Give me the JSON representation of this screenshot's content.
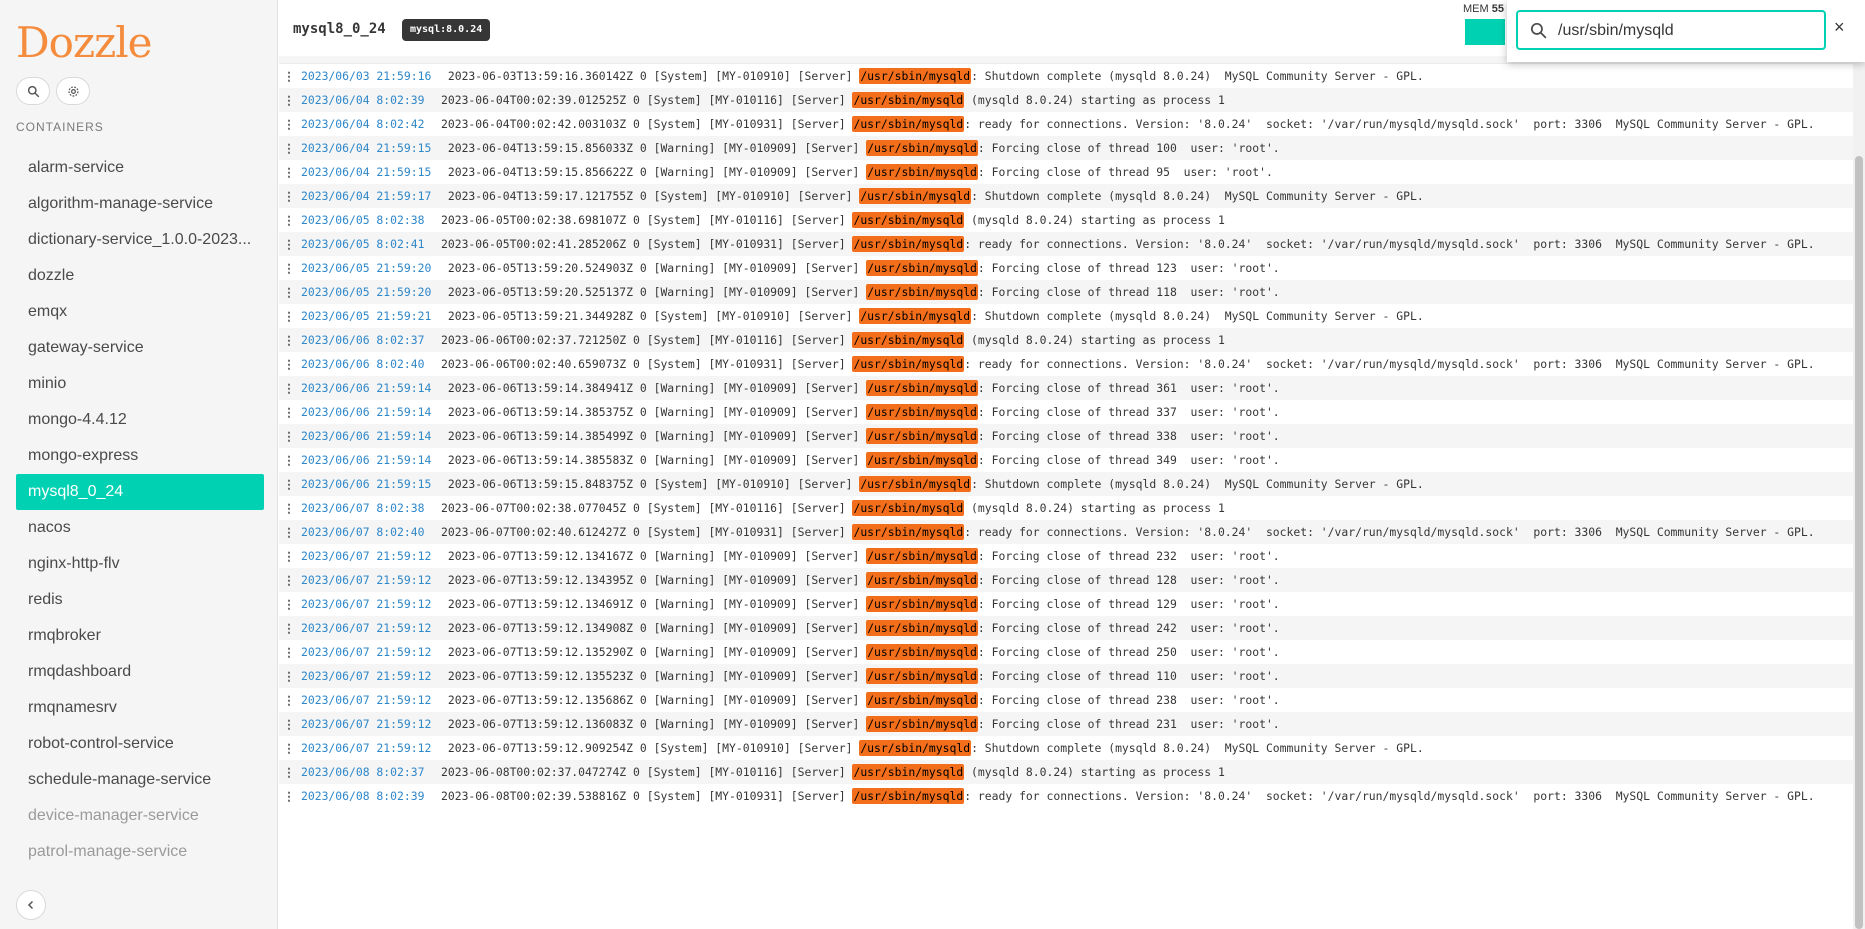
{
  "app": {
    "logo": "Dozzle"
  },
  "sidebar": {
    "section_label": "CONTAINERS",
    "search_icon": "search-icon",
    "settings_icon": "gear-icon",
    "collapse_icon": "chevron-left-icon",
    "containers": [
      {
        "label": "alarm-service",
        "state": "running"
      },
      {
        "label": "algorithm-manage-service",
        "state": "running"
      },
      {
        "label": "dictionary-service_1.0.0-2023...",
        "state": "running"
      },
      {
        "label": "dozzle",
        "state": "running"
      },
      {
        "label": "emqx",
        "state": "running"
      },
      {
        "label": "gateway-service",
        "state": "running"
      },
      {
        "label": "minio",
        "state": "running"
      },
      {
        "label": "mongo-4.4.12",
        "state": "running"
      },
      {
        "label": "mongo-express",
        "state": "running"
      },
      {
        "label": "mysql8_0_24",
        "state": "active"
      },
      {
        "label": "nacos",
        "state": "running"
      },
      {
        "label": "nginx-http-flv",
        "state": "running"
      },
      {
        "label": "redis",
        "state": "running"
      },
      {
        "label": "rmqbroker",
        "state": "running"
      },
      {
        "label": "rmqdashboard",
        "state": "running"
      },
      {
        "label": "rmqnamesrv",
        "state": "running"
      },
      {
        "label": "robot-control-service",
        "state": "running"
      },
      {
        "label": "schedule-manage-service",
        "state": "running"
      },
      {
        "label": "device-manager-service",
        "state": "stopped"
      },
      {
        "label": "patrol-manage-service",
        "state": "stopped"
      }
    ]
  },
  "header": {
    "container_name": "mysql8_0_24",
    "image_tag": "mysql:8.0.24",
    "mem_label": "MEM",
    "mem_value": "55"
  },
  "search": {
    "value": "/usr/sbin/mysqld",
    "close_label": "×"
  },
  "colors": {
    "accent": "#00d1b2",
    "highlight": "#f26e1a",
    "date": "#2e87c9",
    "logo": "#f48b3d"
  },
  "logs": [
    {
      "date": "2023/06/03 21:59:16",
      "pre": " 2023-06-03T13:59:16.360142Z 0 [System] [MY-010910] [Server] ",
      "match": "/usr/sbin/mysqld",
      "post": ": Shutdown complete (mysqld 8.0.24)  MySQL Community Server - GPL."
    },
    {
      "date": "2023/06/04 8:02:39",
      "pre": "2023-06-04T00:02:39.012525Z 0 [System] [MY-010116] [Server] ",
      "match": "/usr/sbin/mysqld",
      "post": " (mysqld 8.0.24) starting as process 1"
    },
    {
      "date": "2023/06/04 8:02:42",
      "pre": "2023-06-04T00:02:42.003103Z 0 [System] [MY-010931] [Server] ",
      "match": "/usr/sbin/mysqld",
      "post": ": ready for connections. Version: '8.0.24'  socket: '/var/run/mysqld/mysqld.sock'  port: 3306  MySQL Community Server - GPL."
    },
    {
      "date": "2023/06/04 21:59:15",
      "pre": " 2023-06-04T13:59:15.856033Z 0 [Warning] [MY-010909] [Server] ",
      "match": "/usr/sbin/mysqld",
      "post": ": Forcing close of thread 100  user: 'root'."
    },
    {
      "date": "2023/06/04 21:59:15",
      "pre": " 2023-06-04T13:59:15.856622Z 0 [Warning] [MY-010909] [Server] ",
      "match": "/usr/sbin/mysqld",
      "post": ": Forcing close of thread 95  user: 'root'."
    },
    {
      "date": "2023/06/04 21:59:17",
      "pre": " 2023-06-04T13:59:17.121755Z 0 [System] [MY-010910] [Server] ",
      "match": "/usr/sbin/mysqld",
      "post": ": Shutdown complete (mysqld 8.0.24)  MySQL Community Server - GPL."
    },
    {
      "date": "2023/06/05 8:02:38",
      "pre": "2023-06-05T00:02:38.698107Z 0 [System] [MY-010116] [Server] ",
      "match": "/usr/sbin/mysqld",
      "post": " (mysqld 8.0.24) starting as process 1"
    },
    {
      "date": "2023/06/05 8:02:41",
      "pre": "2023-06-05T00:02:41.285206Z 0 [System] [MY-010931] [Server] ",
      "match": "/usr/sbin/mysqld",
      "post": ": ready for connections. Version: '8.0.24'  socket: '/var/run/mysqld/mysqld.sock'  port: 3306  MySQL Community Server - GPL."
    },
    {
      "date": "2023/06/05 21:59:20",
      "pre": " 2023-06-05T13:59:20.524903Z 0 [Warning] [MY-010909] [Server] ",
      "match": "/usr/sbin/mysqld",
      "post": ": Forcing close of thread 123  user: 'root'."
    },
    {
      "date": "2023/06/05 21:59:20",
      "pre": " 2023-06-05T13:59:20.525137Z 0 [Warning] [MY-010909] [Server] ",
      "match": "/usr/sbin/mysqld",
      "post": ": Forcing close of thread 118  user: 'root'."
    },
    {
      "date": "2023/06/05 21:59:21",
      "pre": " 2023-06-05T13:59:21.344928Z 0 [System] [MY-010910] [Server] ",
      "match": "/usr/sbin/mysqld",
      "post": ": Shutdown complete (mysqld 8.0.24)  MySQL Community Server - GPL."
    },
    {
      "date": "2023/06/06 8:02:37",
      "pre": "2023-06-06T00:02:37.721250Z 0 [System] [MY-010116] [Server] ",
      "match": "/usr/sbin/mysqld",
      "post": " (mysqld 8.0.24) starting as process 1"
    },
    {
      "date": "2023/06/06 8:02:40",
      "pre": "2023-06-06T00:02:40.659073Z 0 [System] [MY-010931] [Server] ",
      "match": "/usr/sbin/mysqld",
      "post": ": ready for connections. Version: '8.0.24'  socket: '/var/run/mysqld/mysqld.sock'  port: 3306  MySQL Community Server - GPL."
    },
    {
      "date": "2023/06/06 21:59:14",
      "pre": " 2023-06-06T13:59:14.384941Z 0 [Warning] [MY-010909] [Server] ",
      "match": "/usr/sbin/mysqld",
      "post": ": Forcing close of thread 361  user: 'root'."
    },
    {
      "date": "2023/06/06 21:59:14",
      "pre": " 2023-06-06T13:59:14.385375Z 0 [Warning] [MY-010909] [Server] ",
      "match": "/usr/sbin/mysqld",
      "post": ": Forcing close of thread 337  user: 'root'."
    },
    {
      "date": "2023/06/06 21:59:14",
      "pre": " 2023-06-06T13:59:14.385499Z 0 [Warning] [MY-010909] [Server] ",
      "match": "/usr/sbin/mysqld",
      "post": ": Forcing close of thread 338  user: 'root'."
    },
    {
      "date": "2023/06/06 21:59:14",
      "pre": " 2023-06-06T13:59:14.385583Z 0 [Warning] [MY-010909] [Server] ",
      "match": "/usr/sbin/mysqld",
      "post": ": Forcing close of thread 349  user: 'root'."
    },
    {
      "date": "2023/06/06 21:59:15",
      "pre": " 2023-06-06T13:59:15.848375Z 0 [System] [MY-010910] [Server] ",
      "match": "/usr/sbin/mysqld",
      "post": ": Shutdown complete (mysqld 8.0.24)  MySQL Community Server - GPL."
    },
    {
      "date": "2023/06/07 8:02:38",
      "pre": "2023-06-07T00:02:38.077045Z 0 [System] [MY-010116] [Server] ",
      "match": "/usr/sbin/mysqld",
      "post": " (mysqld 8.0.24) starting as process 1"
    },
    {
      "date": "2023/06/07 8:02:40",
      "pre": "2023-06-07T00:02:40.612427Z 0 [System] [MY-010931] [Server] ",
      "match": "/usr/sbin/mysqld",
      "post": ": ready for connections. Version: '8.0.24'  socket: '/var/run/mysqld/mysqld.sock'  port: 3306  MySQL Community Server - GPL."
    },
    {
      "date": "2023/06/07 21:59:12",
      "pre": " 2023-06-07T13:59:12.134167Z 0 [Warning] [MY-010909] [Server] ",
      "match": "/usr/sbin/mysqld",
      "post": ": Forcing close of thread 232  user: 'root'."
    },
    {
      "date": "2023/06/07 21:59:12",
      "pre": " 2023-06-07T13:59:12.134395Z 0 [Warning] [MY-010909] [Server] ",
      "match": "/usr/sbin/mysqld",
      "post": ": Forcing close of thread 128  user: 'root'."
    },
    {
      "date": "2023/06/07 21:59:12",
      "pre": " 2023-06-07T13:59:12.134691Z 0 [Warning] [MY-010909] [Server] ",
      "match": "/usr/sbin/mysqld",
      "post": ": Forcing close of thread 129  user: 'root'."
    },
    {
      "date": "2023/06/07 21:59:12",
      "pre": " 2023-06-07T13:59:12.134908Z 0 [Warning] [MY-010909] [Server] ",
      "match": "/usr/sbin/mysqld",
      "post": ": Forcing close of thread 242  user: 'root'."
    },
    {
      "date": "2023/06/07 21:59:12",
      "pre": " 2023-06-07T13:59:12.135290Z 0 [Warning] [MY-010909] [Server] ",
      "match": "/usr/sbin/mysqld",
      "post": ": Forcing close of thread 250  user: 'root'."
    },
    {
      "date": "2023/06/07 21:59:12",
      "pre": " 2023-06-07T13:59:12.135523Z 0 [Warning] [MY-010909] [Server] ",
      "match": "/usr/sbin/mysqld",
      "post": ": Forcing close of thread 110  user: 'root'."
    },
    {
      "date": "2023/06/07 21:59:12",
      "pre": " 2023-06-07T13:59:12.135686Z 0 [Warning] [MY-010909] [Server] ",
      "match": "/usr/sbin/mysqld",
      "post": ": Forcing close of thread 238  user: 'root'."
    },
    {
      "date": "2023/06/07 21:59:12",
      "pre": " 2023-06-07T13:59:12.136083Z 0 [Warning] [MY-010909] [Server] ",
      "match": "/usr/sbin/mysqld",
      "post": ": Forcing close of thread 231  user: 'root'."
    },
    {
      "date": "2023/06/07 21:59:12",
      "pre": " 2023-06-07T13:59:12.909254Z 0 [System] [MY-010910] [Server] ",
      "match": "/usr/sbin/mysqld",
      "post": ": Shutdown complete (mysqld 8.0.24)  MySQL Community Server - GPL."
    },
    {
      "date": "2023/06/08 8:02:37",
      "pre": "2023-06-08T00:02:37.047274Z 0 [System] [MY-010116] [Server] ",
      "match": "/usr/sbin/mysqld",
      "post": " (mysqld 8.0.24) starting as process 1"
    },
    {
      "date": "2023/06/08 8:02:39",
      "pre": "2023-06-08T00:02:39.538816Z 0 [System] [MY-010931] [Server] ",
      "match": "/usr/sbin/mysqld",
      "post": ": ready for connections. Version: '8.0.24'  socket: '/var/run/mysqld/mysqld.sock'  port: 3306  MySQL Community Server - GPL."
    }
  ]
}
